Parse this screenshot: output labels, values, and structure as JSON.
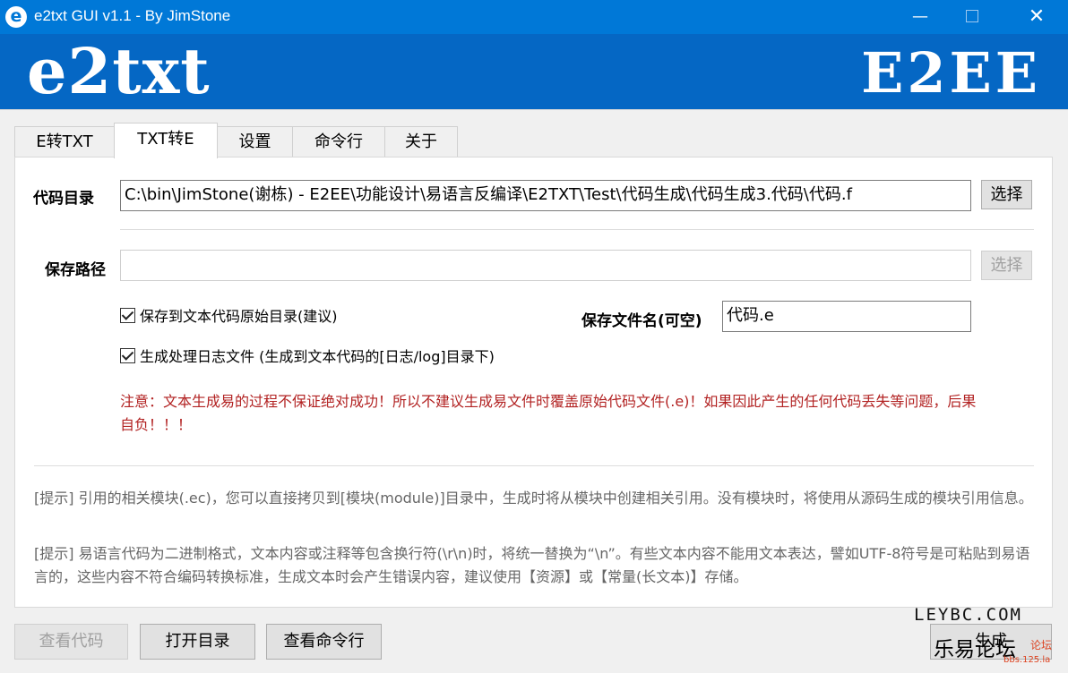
{
  "window": {
    "icon_glyph": "e",
    "title": "e2txt GUI v1.1 - By JimStone",
    "minimize_glyph": "—",
    "close_glyph": "✕"
  },
  "banner": {
    "logo_left": "e2txt",
    "logo_right": "E2EE"
  },
  "tabs": [
    {
      "label": "E转TXT",
      "active": false
    },
    {
      "label": "TXT转E",
      "active": true
    },
    {
      "label": "设置",
      "active": false
    },
    {
      "label": "命令行",
      "active": false
    },
    {
      "label": "关于",
      "active": false
    }
  ],
  "code_dir": {
    "label": "代码目录",
    "value": "C:\\bin\\JimStone(谢栋) - E2EE\\功能设计\\易语言反编译\\E2TXT\\Test\\代码生成\\代码生成3.代码\\代码.f",
    "button": "选择"
  },
  "save_path": {
    "label": "保存路径",
    "value": "",
    "button": "选择"
  },
  "options": {
    "save_original_dir": {
      "label": "保存到文本代码原始目录(建议)",
      "checked": true
    },
    "gen_log": {
      "label": "生成处理日志文件 (生成到文本代码的[日志/log]目录下)",
      "checked": true
    }
  },
  "save_filename": {
    "label": "保存文件名(可空)",
    "value": "代码.e"
  },
  "warning": "注意：文本生成易的过程不保证绝对成功！所以不建议生成易文件时覆盖原始代码文件(.e)！如果因此产生的任何代码丢失等问题，后果自负！！！",
  "hints": [
    "[提示] 引用的相关模块(.ec)，您可以直接拷贝到[模块(module)]目录中，生成时将从模块中创建相关引用。没有模块时，将使用从源码生成的模块引用信息。",
    "[提示] 易语言代码为二进制格式，文本内容或注释等包含换行符(\\r\\n)时，将统一替换为“\\n”。有些文本内容不能用文本表达，譬如UTF-8符号是可粘贴到易语言的，这些内容不符合编码转换标准，生成文本时会产生错误内容，建议使用【资源】或【常量(长文本)】存储。"
  ],
  "footer": {
    "view_code": "查看代码",
    "open_dir": "打开目录",
    "view_cmdline": "查看命令行",
    "generate": "生成"
  },
  "watermark": {
    "line1": "LEYBC.COM",
    "line2": "乐易论坛",
    "small1": "论坛",
    "small2": "bbs.125.la"
  }
}
